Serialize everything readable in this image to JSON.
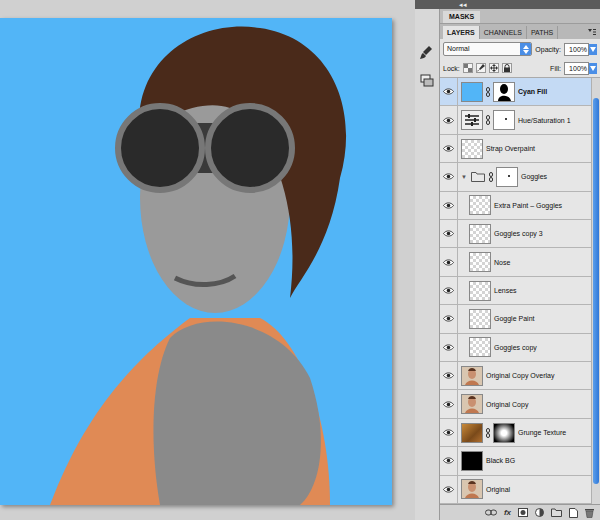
{
  "dock": {
    "collapse": "◂◂"
  },
  "panel": {
    "masks_tab": "MASKS",
    "tabs": [
      {
        "label": "LAYERS",
        "selected": true
      },
      {
        "label": "CHANNELS",
        "selected": false
      },
      {
        "label": "PATHS",
        "selected": false
      }
    ],
    "blend_mode": "Normal",
    "opacity_label": "Opacity:",
    "opacity": "100%",
    "lock_label": "Lock:",
    "fill_label": "Fill:",
    "fill": "100%",
    "footer_fx": "fx"
  },
  "layers": [
    {
      "name": "Cyan Fill",
      "visible": true,
      "selected": true,
      "kind": "cyan",
      "mask": "silhouette",
      "in_group": false
    },
    {
      "name": "Hue/Saturation 1",
      "visible": true,
      "selected": false,
      "kind": "adjustment",
      "mask": "white",
      "in_group": false
    },
    {
      "name": "Strap Overpaint",
      "visible": true,
      "selected": false,
      "kind": "transparent",
      "mask": "none",
      "in_group": false
    },
    {
      "name": "Goggles",
      "visible": true,
      "selected": false,
      "kind": "folder",
      "mask": "white",
      "in_group": false,
      "toggle": "▼",
      "expanded": true
    },
    {
      "name": "Extra Paint – Goggles",
      "visible": true,
      "selected": false,
      "kind": "transparent",
      "mask": "none",
      "in_group": true
    },
    {
      "name": "Goggles copy 3",
      "visible": true,
      "selected": false,
      "kind": "transparent",
      "mask": "none",
      "in_group": true
    },
    {
      "name": "Nose",
      "visible": true,
      "selected": false,
      "kind": "transparent",
      "mask": "none",
      "in_group": true
    },
    {
      "name": "Lenses",
      "visible": true,
      "selected": false,
      "kind": "transparent",
      "mask": "none",
      "in_group": true
    },
    {
      "name": "Goggle Paint",
      "visible": true,
      "selected": false,
      "kind": "transparent",
      "mask": "none",
      "in_group": true
    },
    {
      "name": "Goggles copy",
      "visible": true,
      "selected": false,
      "kind": "transparent",
      "mask": "none",
      "in_group": true
    },
    {
      "name": "Original Copy Overlay",
      "visible": true,
      "selected": false,
      "kind": "photo",
      "mask": "none",
      "in_group": false
    },
    {
      "name": "Original Copy",
      "visible": true,
      "selected": false,
      "kind": "photo",
      "mask": "none",
      "in_group": false
    },
    {
      "name": "Grunge Texture",
      "visible": true,
      "selected": false,
      "kind": "grunge",
      "mask": "radial",
      "in_group": false
    },
    {
      "name": "Black BG",
      "visible": true,
      "selected": false,
      "kind": "black",
      "mask": "none",
      "in_group": false
    },
    {
      "name": "Original",
      "visible": true,
      "selected": false,
      "kind": "photo",
      "mask": "none",
      "in_group": false
    }
  ]
}
